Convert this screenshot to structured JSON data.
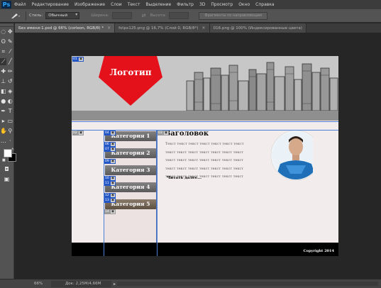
{
  "app": {
    "logo_text": "Ps"
  },
  "menu": [
    "Файл",
    "Редактирование",
    "Изображение",
    "Слои",
    "Текст",
    "Выделение",
    "Фильтр",
    "3D",
    "Просмотр",
    "Окно",
    "Справка"
  ],
  "options": {
    "style_label": "Стиль:",
    "style_value": "Обычный",
    "width_label": "Ширина:",
    "height_label": "Высота:",
    "guides_button": "Фрагменты по направляющим"
  },
  "tabs": [
    {
      "label": "Без имени-1.psd @ 66% (corleon, RGB/8) *",
      "active": true
    },
    {
      "label": "fotpx125.png @ 16,7% (Слой 0, RGB/8*)",
      "active": false
    },
    {
      "label": "016.png @ 100% (Индексированные цвета)",
      "active": false
    }
  ],
  "status": {
    "zoom": "66%",
    "doc_info": "Док: 2,25M/4,66M",
    "arrow": "▸"
  },
  "document": {
    "logo_text": "Логотип",
    "heading": "Заголовок",
    "body_lines": [
      "Текст текст текст текст текст текст текст",
      "текст текст текст текст текст текст текст",
      "текст текст текст текст текст текст текст",
      "текст текст текст текст текст текст текст",
      "текст текст текст текст текст текст текст"
    ],
    "read_more": "Читать далее...",
    "categories": [
      "Категория 1",
      "Категория 2",
      "Категория 3",
      "Категория 4",
      "Категория 5"
    ],
    "copyright": "Copyright 2014"
  },
  "slices": {
    "s01": "01",
    "s02": "02",
    "s03": "03",
    "s04": "04",
    "s06": "06",
    "s07": "07",
    "s09": "09",
    "s10": "10",
    "s11": "11",
    "s12": "12",
    "s13": "13",
    "s14": "14"
  },
  "colors": {
    "logo_red": "#e4101a",
    "slice_blue": "#2457c5",
    "footer": "#000000",
    "hover_category": "#8a7a6a"
  }
}
